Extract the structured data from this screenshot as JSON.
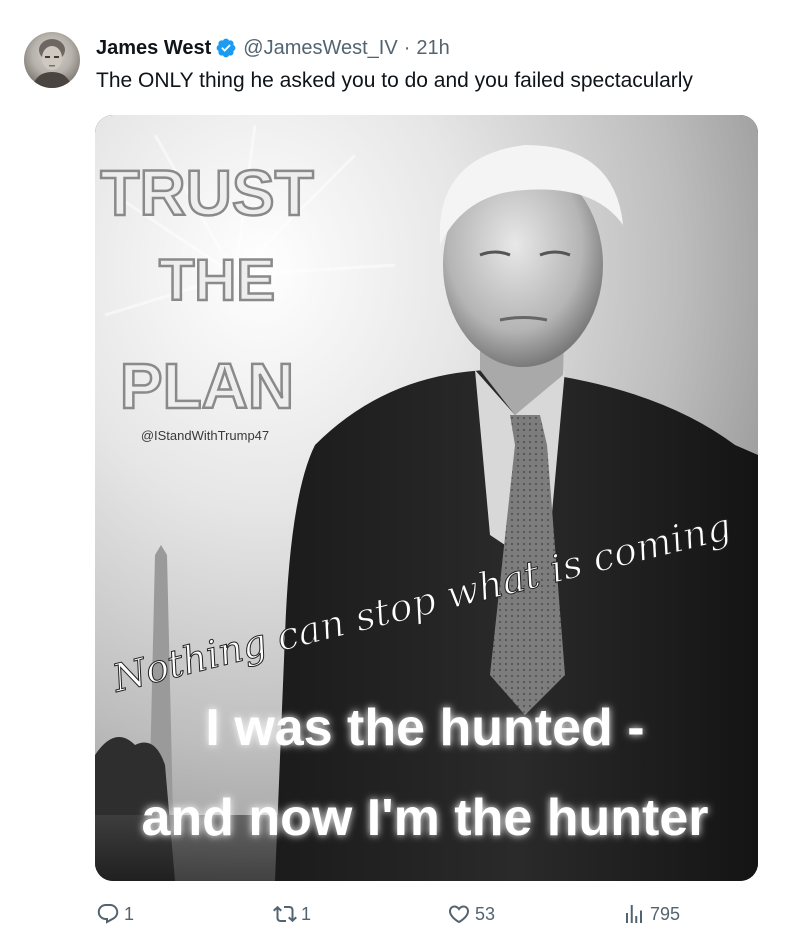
{
  "tweet": {
    "author": {
      "display_name": "James West",
      "handle": "@JamesWest_IV",
      "verified": true,
      "avatar_icon": "user-avatar"
    },
    "separator": "·",
    "time": "21h",
    "text": "The ONLY thing he asked you to do and you failed spectacularly"
  },
  "media": {
    "headline_lines": [
      "TRUST",
      "THE",
      "PLAN"
    ],
    "watermark": "@IStandWithTrump47",
    "script_caption": "Nothing can stop what is coming",
    "bottom_lines": [
      "I  was the hunted -",
      "and now I'm the hunter"
    ]
  },
  "actions": {
    "reply": {
      "icon": "reply-icon",
      "count": "1"
    },
    "retweet": {
      "icon": "retweet-icon",
      "count": "1"
    },
    "like": {
      "icon": "heart-icon",
      "count": "53"
    },
    "views": {
      "icon": "views-icon",
      "count": "795"
    }
  },
  "colors": {
    "verified_blue": "#1d9bf0",
    "secondary_text": "#536471",
    "primary_text": "#0f1419"
  }
}
